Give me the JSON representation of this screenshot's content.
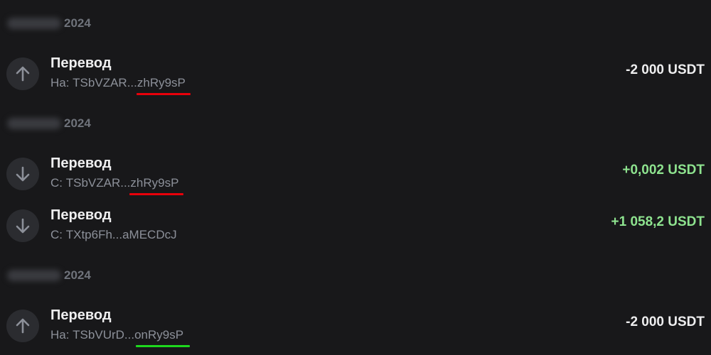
{
  "colors": {
    "background": "#18181a",
    "primary_text": "#eeeeef",
    "secondary_text": "#8c9099",
    "positive_amount": "#8ee38f",
    "icon_bg": "#2b2c30",
    "annotation_red": "#e8000a",
    "annotation_green": "#1ed81e"
  },
  "groups": [
    {
      "date_suffix": "2024",
      "transactions": [
        {
          "icon": "arrow-up-icon",
          "title": "Перевод",
          "subtitle": "На: TSbVZAR...zhRy9sP",
          "amount": "-2 000 USDT",
          "direction": "out",
          "annotation": "red-underline"
        }
      ]
    },
    {
      "date_suffix": "2024",
      "transactions": [
        {
          "icon": "arrow-down-icon",
          "title": "Перевод",
          "subtitle": "С: TSbVZAR...zhRy9sP",
          "amount": "+0,002 USDT",
          "direction": "in",
          "annotation": "red-underline"
        },
        {
          "icon": "arrow-down-icon",
          "title": "Перевод",
          "subtitle": "С: TXtp6Fh...aMECDcJ",
          "amount": "+1 058,2 USDT",
          "direction": "in"
        }
      ]
    },
    {
      "date_suffix": "2024",
      "transactions": [
        {
          "icon": "arrow-up-icon",
          "title": "Перевод",
          "subtitle": "На: TSbVUrD...onRy9sP",
          "amount": "-2 000 USDT",
          "direction": "out",
          "annotation": "green-underline"
        }
      ]
    }
  ]
}
